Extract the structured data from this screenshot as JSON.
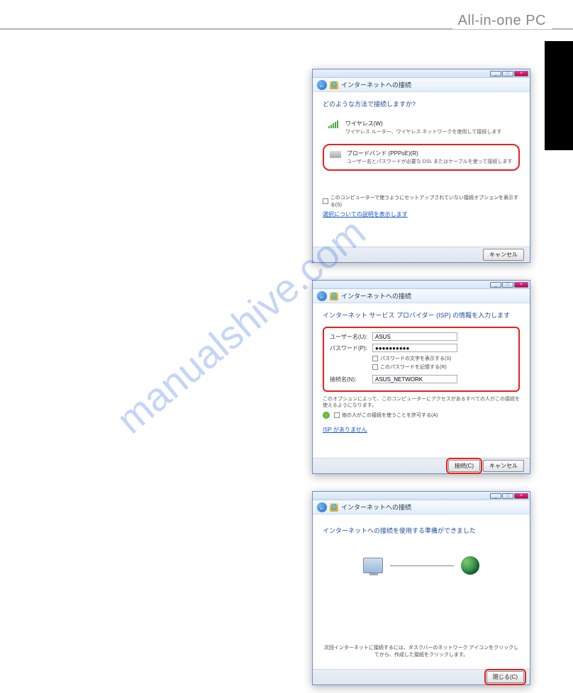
{
  "header": {
    "brand": "All-in-one PC"
  },
  "watermark": "manualshive.com",
  "dialog1": {
    "window_title": "インターネットへの接続",
    "prompt": "どのような方法で接続しますか?",
    "option_wireless": {
      "title": "ワイヤレス(W)",
      "desc": "ワイヤレス ルーター、ワイヤレス ネットワークを使用して接続します"
    },
    "option_broadband": {
      "title": "ブロードバンド (PPPoE)(R)",
      "desc": "ユーザー名とパスワードが必要な DSL またはケーブルを使って接続します"
    },
    "show_all_check": "このコンピューターで使うようにセットアップされていない接続オプションを表示する(S)",
    "help_link": "選択についての説明を表示します",
    "cancel": "キャンセル"
  },
  "dialog2": {
    "window_title": "インターネットへの接続",
    "prompt": "インターネット サービス プロバイダー (ISP) の情報を入力します",
    "username_label": "ユーザー名(U):",
    "username_value": "ASUS",
    "password_label": "パスワード(P):",
    "password_value": "●●●●●●●●●●",
    "show_pw_check": "パスワードの文字を表示する(S)",
    "remember_pw_check": "このパスワードを記憶する(R)",
    "connection_name_label": "接続名(N):",
    "connection_name_value": "ASUS_NETWORK",
    "share_note": "このオプションによって、このコンピューターにアクセスがあるすべての人がこの接続を使えるようになります。",
    "allow_others_check": "他の人がこの接続を使うことを許可する(A)",
    "no_isp_link": "ISP がありません",
    "connect_btn": "接続(C)",
    "cancel": "キャンセル"
  },
  "dialog3": {
    "window_title": "インターネットへの接続",
    "ready_msg": "インターネットへの接続を使用する準備ができました",
    "instruction": "次回インターネットに接続するには、タスクバーのネットワーク\nアイコンをクリックしてから、作成した接続をクリックします。",
    "close_btn": "閉じる(C)"
  }
}
